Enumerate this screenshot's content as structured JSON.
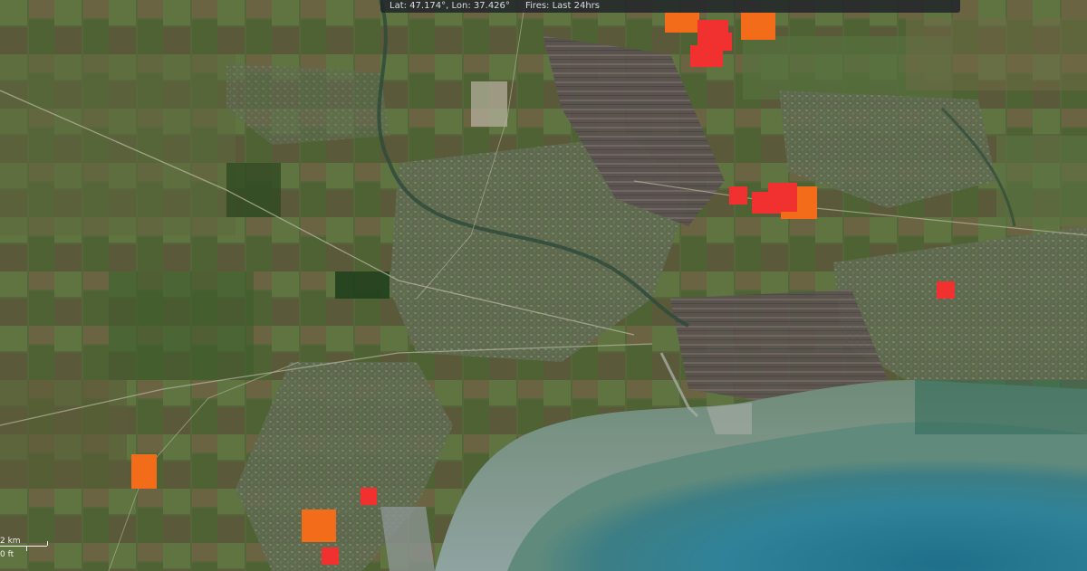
{
  "infobar": {
    "coords": "Lat: 47.174°, Lon: 37.426°",
    "fires": "Fires: Last 24hrs"
  },
  "scale": {
    "km_label": "2 km",
    "ft_label": "0 ft"
  },
  "colors": {
    "fire_red": "#f0312f",
    "fire_orange": "#f26c1a",
    "sea": "#2f7f96",
    "shallow_water": "#8fa79a",
    "land": "#4c5b35",
    "urban": "#6e7460"
  },
  "fires": [
    {
      "type": "orange"
    },
    {
      "type": "orange"
    },
    {
      "type": "red"
    },
    {
      "type": "red"
    },
    {
      "type": "red"
    },
    {
      "type": "red"
    },
    {
      "type": "red"
    },
    {
      "type": "orange"
    },
    {
      "type": "red"
    },
    {
      "type": "orange"
    },
    {
      "type": "red"
    },
    {
      "type": "orange"
    },
    {
      "type": "red"
    },
    {
      "type": "red"
    }
  ]
}
